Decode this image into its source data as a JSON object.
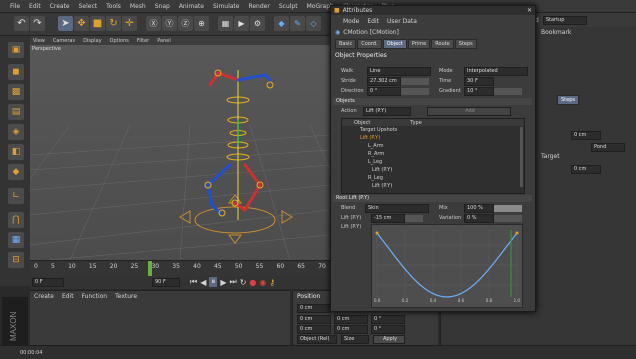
{
  "menubar": [
    "File",
    "Edit",
    "Create",
    "Select",
    "Tools",
    "Mesh",
    "Snap",
    "Animate",
    "Simulate",
    "Render",
    "Sculpt",
    "MoGraph",
    "Character",
    "Plug"
  ],
  "right_header": {
    "layout_label": "ord",
    "layout_value": "Startup",
    "bookmarks": "Bookmark"
  },
  "viewport": {
    "menus": [
      "View",
      "Cameras",
      "Display",
      "Options",
      "Filter",
      "Panel"
    ],
    "label": "Perspective"
  },
  "timeline": {
    "ticks": [
      "0",
      "5",
      "10",
      "15",
      "20",
      "25",
      "30",
      "35",
      "40",
      "45",
      "50",
      "55",
      "60",
      "65",
      "70"
    ],
    "frame_start": "0 F",
    "frame_end": "90 F"
  },
  "materials": {
    "menus": [
      "Create",
      "Edit",
      "Function",
      "Texture"
    ]
  },
  "coords": {
    "title": "Position",
    "rows": [
      [
        "0 cm",
        "0 cm",
        "0 °"
      ],
      [
        "0 cm",
        "0 cm",
        "0 °"
      ],
      [
        "0 cm",
        "0 cm",
        "0 °"
      ]
    ],
    "mode": "Object (Rel)",
    "size": "Size",
    "apply": "Apply"
  },
  "status": {
    "time": "00:00:04"
  },
  "attributes": {
    "title": "Attributes",
    "menus": [
      "Mode",
      "Edit",
      "User Data"
    ],
    "object_name": "CMotion [CMotion]",
    "tabs": [
      "Basic",
      "Coord.",
      "Object",
      "Prime",
      "Route",
      "Steps"
    ],
    "active_tab": "Object",
    "section_object": "Object Properties",
    "walk_label": "Walk",
    "walk_value": "Line",
    "mode_label": "Mode",
    "mode_value": "Interpolated",
    "stride_label": "Stride",
    "stride_value": "27.302 cm",
    "time_label": "Time",
    "time_value": "30 F",
    "direction_label": "Direction",
    "direction_value": "0 °",
    "gradient_label": "Gradient",
    "gradient_value": "10 °",
    "section_objects": "Objects",
    "action_label": "Action",
    "action_value": "Lift (P.Y)",
    "add_label": "Add",
    "list_col_object": "Object",
    "list_col_type": "Type",
    "list_items": [
      "Target Upshots",
      "Lift (P.Y)",
      "L_Arm",
      "R_Arm",
      "L_Leg",
      "Lift (P.Y)",
      "R_Leg",
      "Lift (P.Y)"
    ],
    "section_lift": "Root Lift (P.Y)",
    "blend_label": "Blend",
    "blend_value": "Skin",
    "mix_label": "Mix",
    "mix_value": "100 %",
    "lift_label": "Lift (P.Y)",
    "lift_value": "-15 cm",
    "variation_label": "Variation",
    "variation_value": "0 %",
    "lift_curve_label": "Lift (P.Y)",
    "graph_ticks": [
      "0.0",
      "0.2",
      "0.4",
      "0.6",
      "0.8",
      "1.0"
    ]
  },
  "right_fields": {
    "steps_tab": "Steps",
    "pond_value": "Pond",
    "target_label": "Target",
    "cm1": "0 cm",
    "cm2": "0 cm"
  },
  "colors": {
    "accent": "#e0a030",
    "selection": "#5b6a82",
    "curve": "#6ab0ff"
  }
}
